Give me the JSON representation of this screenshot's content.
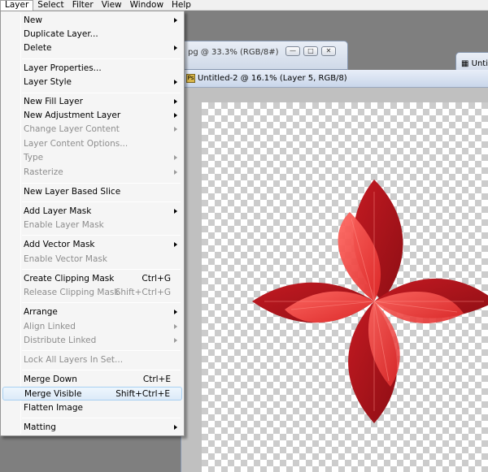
{
  "menubar": {
    "items": [
      "Layer",
      "Select",
      "Filter",
      "View",
      "Window",
      "Help"
    ]
  },
  "back_window": {
    "title": "pg @ 33.3% (RGB/8#)"
  },
  "far_window": {
    "title": "Unti"
  },
  "document": {
    "title": "Untitled-2 @ 16.1% (Layer 5, RGB/8)"
  },
  "layer_menu": {
    "items": [
      {
        "label": "New",
        "shortcut": "",
        "submenu": true,
        "disabled": false
      },
      {
        "label": "Duplicate Layer...",
        "shortcut": "",
        "submenu": false,
        "disabled": false
      },
      {
        "label": "Delete",
        "shortcut": "",
        "submenu": true,
        "disabled": false
      },
      {
        "label": "Layer Properties...",
        "shortcut": "",
        "submenu": false,
        "disabled": false
      },
      {
        "label": "Layer Style",
        "shortcut": "",
        "submenu": true,
        "disabled": false
      },
      {
        "label": "New Fill Layer",
        "shortcut": "",
        "submenu": true,
        "disabled": false
      },
      {
        "label": "New Adjustment Layer",
        "shortcut": "",
        "submenu": true,
        "disabled": false
      },
      {
        "label": "Change Layer Content",
        "shortcut": "",
        "submenu": true,
        "disabled": true
      },
      {
        "label": "Layer Content Options...",
        "shortcut": "",
        "submenu": false,
        "disabled": true
      },
      {
        "label": "Type",
        "shortcut": "",
        "submenu": true,
        "disabled": true
      },
      {
        "label": "Rasterize",
        "shortcut": "",
        "submenu": true,
        "disabled": true
      },
      {
        "label": "New Layer Based Slice",
        "shortcut": "",
        "submenu": false,
        "disabled": false
      },
      {
        "label": "Add Layer Mask",
        "shortcut": "",
        "submenu": true,
        "disabled": false
      },
      {
        "label": "Enable Layer Mask",
        "shortcut": "",
        "submenu": false,
        "disabled": true
      },
      {
        "label": "Add Vector Mask",
        "shortcut": "",
        "submenu": true,
        "disabled": false
      },
      {
        "label": "Enable Vector Mask",
        "shortcut": "",
        "submenu": false,
        "disabled": true
      },
      {
        "label": "Create Clipping Mask",
        "shortcut": "Ctrl+G",
        "submenu": false,
        "disabled": false
      },
      {
        "label": "Release Clipping Mask",
        "shortcut": "Shift+Ctrl+G",
        "submenu": false,
        "disabled": true
      },
      {
        "label": "Arrange",
        "shortcut": "",
        "submenu": true,
        "disabled": false
      },
      {
        "label": "Align Linked",
        "shortcut": "",
        "submenu": true,
        "disabled": true
      },
      {
        "label": "Distribute Linked",
        "shortcut": "",
        "submenu": true,
        "disabled": true
      },
      {
        "label": "Lock All Layers In Set...",
        "shortcut": "",
        "submenu": false,
        "disabled": true
      },
      {
        "label": "Merge Down",
        "shortcut": "Ctrl+E",
        "submenu": false,
        "disabled": false
      },
      {
        "label": "Merge Visible",
        "shortcut": "Shift+Ctrl+E",
        "submenu": false,
        "disabled": false,
        "highlighted": true
      },
      {
        "label": "Flatten Image",
        "shortcut": "",
        "submenu": false,
        "disabled": false
      },
      {
        "label": "Matting",
        "shortcut": "",
        "submenu": true,
        "disabled": false
      }
    ]
  },
  "colors": {
    "menu_highlight_border": "#a8d0f2",
    "leaf_dark": "#b3151c",
    "leaf_light": "#f0443f"
  }
}
